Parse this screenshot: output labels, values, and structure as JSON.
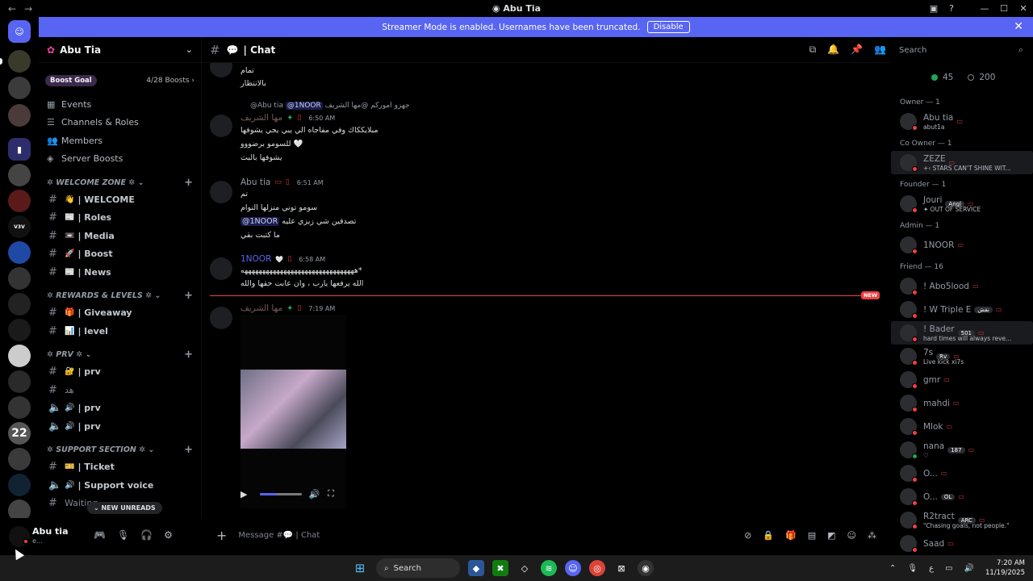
{
  "window": {
    "title": "Abu Tia",
    "nav_back": "←",
    "nav_forward": "→"
  },
  "banner": {
    "text": "Streamer Mode is enabled. Usernames have been truncated.",
    "button": "Disable",
    "close": "✕"
  },
  "guild": {
    "name": "Abu Tia",
    "chevron": "⌄"
  },
  "boost_goal": {
    "label": "Boost Goal",
    "progress": "4/28 Boosts ›"
  },
  "sidebar_items": [
    {
      "icon": "calendar-icon",
      "label": "Events"
    },
    {
      "icon": "channels-icon",
      "label": "Channels & Roles"
    },
    {
      "icon": "members-icon",
      "label": "Members"
    },
    {
      "icon": "boost-icon",
      "label": "Server Boosts"
    }
  ],
  "categories": [
    {
      "name": "✲ WELCOME ZONE ✲ ⌄",
      "channels": [
        {
          "emoji": "👋",
          "name": "| WELCOME"
        },
        {
          "emoji": "📰",
          "name": "| Roles"
        },
        {
          "emoji": "📼",
          "name": "| Media"
        },
        {
          "emoji": "🚀",
          "name": "| Boost"
        },
        {
          "emoji": "📰",
          "name": "| News"
        }
      ]
    },
    {
      "name": "✲ REWARDS & LEVELS ✲ ⌄",
      "channels": [
        {
          "emoji": "🎁",
          "name": "| Giveaway"
        },
        {
          "emoji": "📊",
          "name": "| level"
        }
      ]
    },
    {
      "name": "✲ PRV ✲ ⌄",
      "channels": [
        {
          "emoji": "🔐",
          "name": "| prv"
        },
        {
          "emoji": "",
          "name": "هد"
        },
        {
          "emoji": "🔊",
          "name": "| prv"
        },
        {
          "emoji": "🔊",
          "name": "| prv"
        }
      ]
    },
    {
      "name": "✲ SUPPORT SECTION ✲ ⌄",
      "channels": [
        {
          "emoji": "🎫",
          "name": "| Ticket"
        },
        {
          "emoji": "🔊",
          "name": "| Support voice"
        },
        {
          "emoji": "",
          "name": "Waiting"
        }
      ]
    }
  ],
  "new_unreads": "⌄ NEW UNREADS",
  "user_panel": {
    "name": "Abu tia",
    "status": "e..."
  },
  "channel_header": {
    "name": "| Chat"
  },
  "search": {
    "placeholder": "Search"
  },
  "messages": {
    "top_lines": [
      "تمام",
      "بالانتظار"
    ],
    "m1": {
      "reply": "@Abu tia",
      "reply_mention": "@1NOOR",
      "reply_text": "جهزو اموركم @مها الشريف",
      "author": "مها الشريف",
      "time": "6:50 AM",
      "lines": [
        "مبلايككاك وفي مفاجاه الي يبي يجي يشوفها",
        "للسومو برضووو 🤍",
        "يشوفها بالبث"
      ]
    },
    "m2": {
      "author": "Abu tia",
      "time": "6:51 AM",
      "lines": [
        "تم",
        "سومو توني منزلها النوام",
        "تصدقين شي زيزي عليه",
        "ما كتبت بقي"
      ],
      "mention": "@1NOOR"
    },
    "m3": {
      "author": "1NOOR",
      "time": "6:58 AM",
      "lines": [
        "ههههههههههههههههههههههههههههههههه*",
        "الله يرفعها يارب ، وان عابت حقها والله"
      ]
    },
    "new_tag": "NEW",
    "m4": {
      "author": "مها الشريف",
      "time": "7:19 AM"
    }
  },
  "video": {
    "progress": 0.4
  },
  "composer": {
    "placeholder": "Message #💬 | Chat"
  },
  "members": {
    "online": "45",
    "total": "200",
    "groups": [
      {
        "role": "Owner — 1",
        "members": [
          {
            "name": "Abu tia",
            "sub": "abut1a",
            "online": false
          }
        ]
      },
      {
        "role": "Co Owner — 1",
        "members": [
          {
            "name": "ZEZE",
            "sub": "+‹ STARS CAN'T SHINE WIT...",
            "online": false,
            "hl": true
          }
        ]
      },
      {
        "role": "Founder — 1",
        "members": [
          {
            "name": "Jouri",
            "tag": "Angl",
            "sub": "✦ OUT OF SERVICE",
            "online": false
          }
        ]
      },
      {
        "role": "Admin — 1",
        "members": [
          {
            "name": "1NOOR",
            "online": false
          }
        ]
      },
      {
        "role": "Friend — 16",
        "members": [
          {
            "name": "! Abo5lood",
            "online": false
          },
          {
            "name": "! W Triple E",
            "tag": "نقش",
            "online": false
          },
          {
            "name": "! Bader",
            "tag": "501",
            "sub": "hard times will always reve...",
            "online": false,
            "hl": true
          },
          {
            "name": "7s",
            "tag": "Rv",
            "sub": "Live kick xi7s",
            "online": false
          },
          {
            "name": "gmr",
            "online": false
          },
          {
            "name": "mahdi",
            "online": false
          },
          {
            "name": "Mlok",
            "online": false
          },
          {
            "name": "nana",
            "tag": "187",
            "sub": "♡",
            "online": true
          },
          {
            "name": "O...",
            "online": false
          },
          {
            "name": "O...",
            "tag": "OL",
            "online": false
          },
          {
            "name": "R2tract",
            "tag": "ARC",
            "sub": "\"Chasing goals, not people.\"",
            "online": false
          },
          {
            "name": "Saad",
            "online": false
          }
        ]
      }
    ]
  },
  "taskbar": {
    "search": "Search",
    "time": "7:20 AM",
    "date": "11/19/2025",
    "lang": "ع"
  },
  "colors": {
    "accent": "#5865f2",
    "danger": "#f23f43",
    "online": "#23a55a"
  }
}
